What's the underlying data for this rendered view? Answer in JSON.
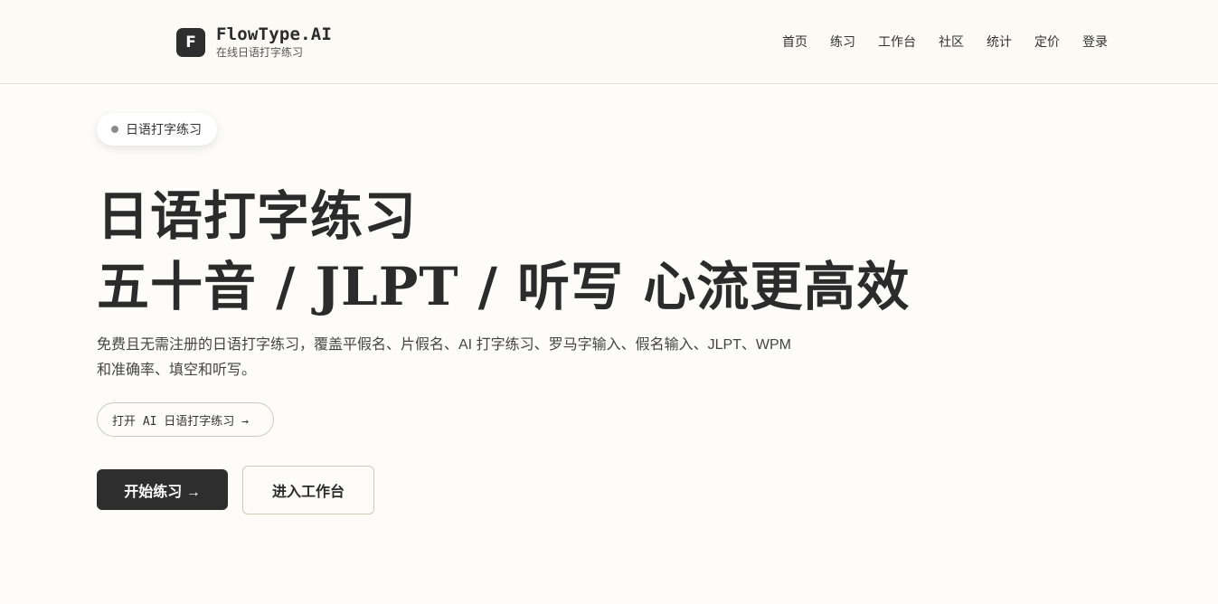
{
  "brand": {
    "logo_letter": "F",
    "name": "FlowType.AI",
    "subtitle": "在线日语打字练习"
  },
  "nav": {
    "items": [
      "首页",
      "练习",
      "工作台",
      "社区",
      "统计",
      "定价",
      "登录"
    ]
  },
  "hero": {
    "badge": "日语打字练习",
    "title_line1": "日语打字练习",
    "title_line2": "五十音 / JLPT / 听写 心流更高效",
    "description": "免费且无需注册的日语打字练习，覆盖平假名、片假名、AI 打字练习、罗马字输入、假名输入、JLPT、WPM 和准确率、填空和听写。",
    "ai_link": "打开 AI 日语打字练习 →",
    "primary_button": "开始练习 →",
    "secondary_button": "进入工作台"
  },
  "colors": {
    "background": "#fdfcf8",
    "primary": "#2e2e2e",
    "border": "#cfc9bb"
  }
}
